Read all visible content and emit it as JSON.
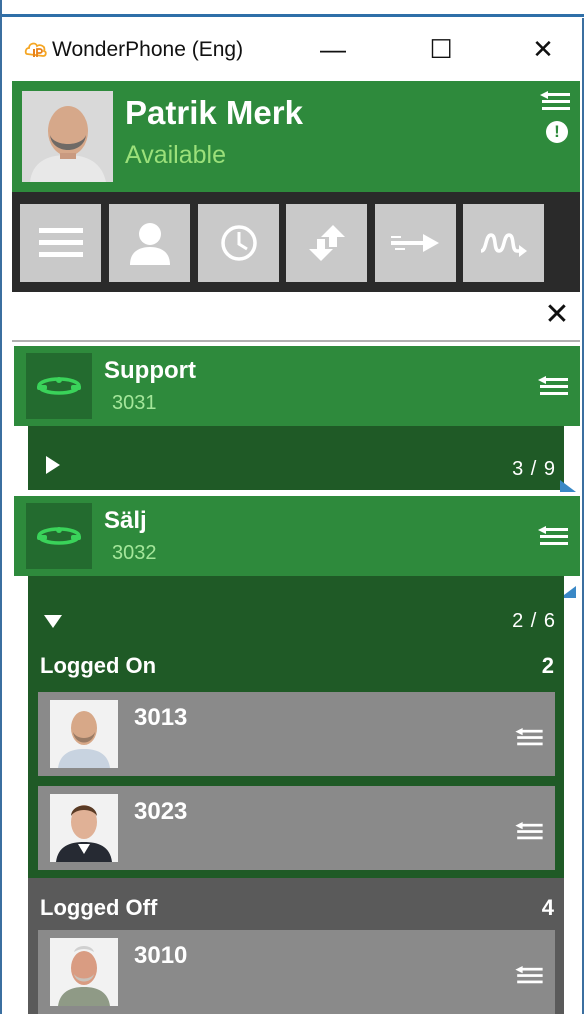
{
  "window": {
    "title": "WonderPhone (Eng)",
    "controls": {
      "minimize": "—",
      "maximize": "☐",
      "close": "✕"
    }
  },
  "user": {
    "name": "Patrik Merk",
    "status": "Available"
  },
  "toolbar": {
    "buttons": [
      "menu-icon",
      "contacts-icon",
      "history-icon",
      "transfer-icon",
      "forward-icon",
      "signal-icon"
    ]
  },
  "search": {
    "value": "",
    "placeholder": "",
    "clear": "✕"
  },
  "groups": [
    {
      "name": "Support",
      "number": "3031",
      "expanded": false,
      "counter": "3 / 9"
    },
    {
      "name": "Sälj",
      "number": "3032",
      "expanded": true,
      "counter": "2 / 6",
      "logged_on": {
        "label": "Logged On",
        "count": "2",
        "members": [
          "3013",
          "3023"
        ]
      },
      "logged_off": {
        "label": "Logged Off",
        "count": "4",
        "members": [
          "3010"
        ]
      }
    }
  ],
  "colors": {
    "green": "#2e8a3c",
    "dark_green": "#1f5a26",
    "status_green": "#9be07a",
    "toolbar_dark": "#2a2a2a",
    "member_gray": "#8a8a8a"
  }
}
